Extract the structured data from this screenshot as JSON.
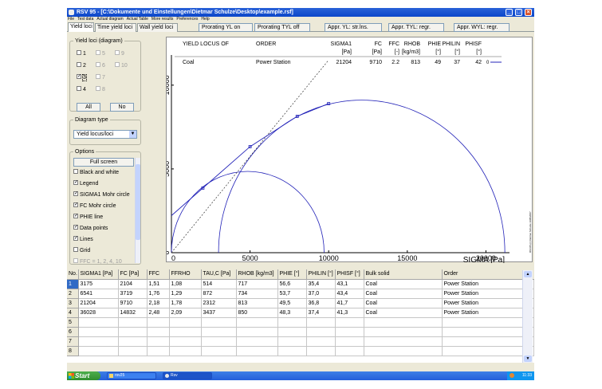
{
  "window": {
    "title": "RSV 95 - [C:\\Dokumente und Einstellungen\\Dietmar Schulze\\Desktop\\example.rsf]",
    "menu": [
      "File",
      "Test data",
      "Actual diagram",
      "Actual Table",
      "More results",
      "Preferences",
      "Help"
    ]
  },
  "tabs": [
    "Yield loci",
    "Time yield loci",
    "Wall yield loci"
  ],
  "toolbar_buttons": [
    "Prorating YL on",
    "Prorating TYL off",
    "Appr. YL: str.lns.",
    "Appr. TYL: regr.",
    "Appr. WYL: regr."
  ],
  "sidebar": {
    "yield_loci_title": "Yield loci (diagram)",
    "checkboxes": [
      {
        "label": "1",
        "checked": false,
        "enabled": true
      },
      {
        "label": "5",
        "checked": false,
        "enabled": false
      },
      {
        "label": "9",
        "checked": false,
        "enabled": false
      },
      {
        "label": "2",
        "checked": false,
        "enabled": true
      },
      {
        "label": "6",
        "checked": false,
        "enabled": false
      },
      {
        "label": "10",
        "checked": false,
        "enabled": false
      },
      {
        "label": "3",
        "checked": true,
        "enabled": true
      },
      {
        "label": "7",
        "checked": false,
        "enabled": false
      },
      {
        "label": "4",
        "checked": false,
        "enabled": true
      },
      {
        "label": "8",
        "checked": false,
        "enabled": false
      }
    ],
    "all_label": "All",
    "no_label": "No",
    "diagram_type_title": "Diagram type",
    "diagram_type_value": "Yield locus/loci",
    "options_title": "Options",
    "full_screen_label": "Full screen",
    "options": [
      {
        "label": "Black and white",
        "checked": false,
        "enabled": true
      },
      {
        "label": "Legend",
        "checked": true,
        "enabled": true
      },
      {
        "label": "SIGMA1 Mohr circle",
        "checked": true,
        "enabled": true
      },
      {
        "label": "FC Mohr circle",
        "checked": true,
        "enabled": true
      },
      {
        "label": "PHIE line",
        "checked": true,
        "enabled": true
      },
      {
        "label": "Data points",
        "checked": true,
        "enabled": true
      },
      {
        "label": "Lines",
        "checked": true,
        "enabled": true
      },
      {
        "label": "Grid",
        "checked": false,
        "enabled": true
      },
      {
        "label": "FFC = 1, 2, 4, 10",
        "checked": false,
        "enabled": false
      }
    ]
  },
  "legend": {
    "headers": [
      {
        "top": "YIELD LOCUS OF",
        "unit": ""
      },
      {
        "top": "ORDER",
        "unit": ""
      },
      {
        "top": "SIGMA1",
        "unit": "[Pa]"
      },
      {
        "top": "FC",
        "unit": "[Pa]"
      },
      {
        "top": "FFC",
        "unit": "[-]"
      },
      {
        "top": "RHOB",
        "unit": "[kg/m3]"
      },
      {
        "top": "PHIE",
        "unit": "[°]"
      },
      {
        "top": "PHILIN",
        "unit": "[°]"
      },
      {
        "top": "PHISF",
        "unit": "[°]"
      }
    ],
    "row": [
      "Coal",
      "Power Station",
      "21204",
      "9710",
      "2.2",
      "813",
      "49",
      "37",
      "42"
    ],
    "marker_label": "0"
  },
  "side_note": "RSV95 (c) Dietmar Schulze 1995/2007",
  "chart_data": {
    "type": "line",
    "xlabel": "SIGMA [Pa]",
    "ylabel": "TAU [Pa]",
    "xlim": [
      0,
      21500
    ],
    "ylim": [
      0,
      11800
    ],
    "x_ticks": [
      0,
      5000,
      10000,
      15000,
      20000
    ],
    "y_ticks": [
      0,
      5000,
      10000
    ],
    "grid": false,
    "legend_position": "top",
    "color": "#2323b8",
    "series": [
      {
        "name": "Coal",
        "points": [
          [
            2000,
            3860
          ],
          [
            5000,
            6330
          ],
          [
            8000,
            8140
          ],
          [
            10000,
            8900
          ]
        ]
      }
    ],
    "mohr_circles": [
      {
        "center": 4855,
        "radius": 4855
      },
      {
        "center": 12100,
        "radius": 9104
      }
    ],
    "phie_line": {
      "slope_deg": 49
    }
  },
  "table": {
    "columns": [
      "No.",
      "SIGMA1 [Pa]",
      "FC [Pa]",
      "FFC",
      "FFRHO",
      "TAU,C [Pa]",
      "RHOB [kg/m3]",
      "PHIE [°]",
      "PHILIN [°]",
      "PHISF [°]",
      "Bulk solid",
      "Order"
    ],
    "rows": [
      [
        "1",
        "3175",
        "2104",
        "1,51",
        "1,08",
        "514",
        "717",
        "56,6",
        "35,4",
        "43,1",
        "Coal",
        "Power Station"
      ],
      [
        "2",
        "6541",
        "3719",
        "1,76",
        "1,29",
        "872",
        "734",
        "53,7",
        "37,0",
        "43,4",
        "Coal",
        "Power Station"
      ],
      [
        "3",
        "21204",
        "9710",
        "2,18",
        "1,78",
        "2312",
        "813",
        "49,5",
        "36,8",
        "41,7",
        "Coal",
        "Power Station"
      ],
      [
        "4",
        "36028",
        "14832",
        "2,48",
        "2,09",
        "3437",
        "850",
        "48,3",
        "37,4",
        "41,3",
        "Coal",
        "Power Station"
      ],
      [
        "5",
        "",
        "",
        "",
        "",
        "",
        "",
        "",
        "",
        "",
        "",
        ""
      ],
      [
        "6",
        "",
        "",
        "",
        "",
        "",
        "",
        "",
        "",
        "",
        "",
        ""
      ],
      [
        "7",
        "",
        "",
        "",
        "",
        "",
        "",
        "",
        "",
        "",
        "",
        ""
      ],
      [
        "8",
        "",
        "",
        "",
        "",
        "",
        "",
        "",
        "",
        "",
        "",
        ""
      ]
    ]
  },
  "taskbar": {
    "start": "Start",
    "tasks": [
      "rsv25",
      "Rsv"
    ],
    "clock": "11:33"
  }
}
